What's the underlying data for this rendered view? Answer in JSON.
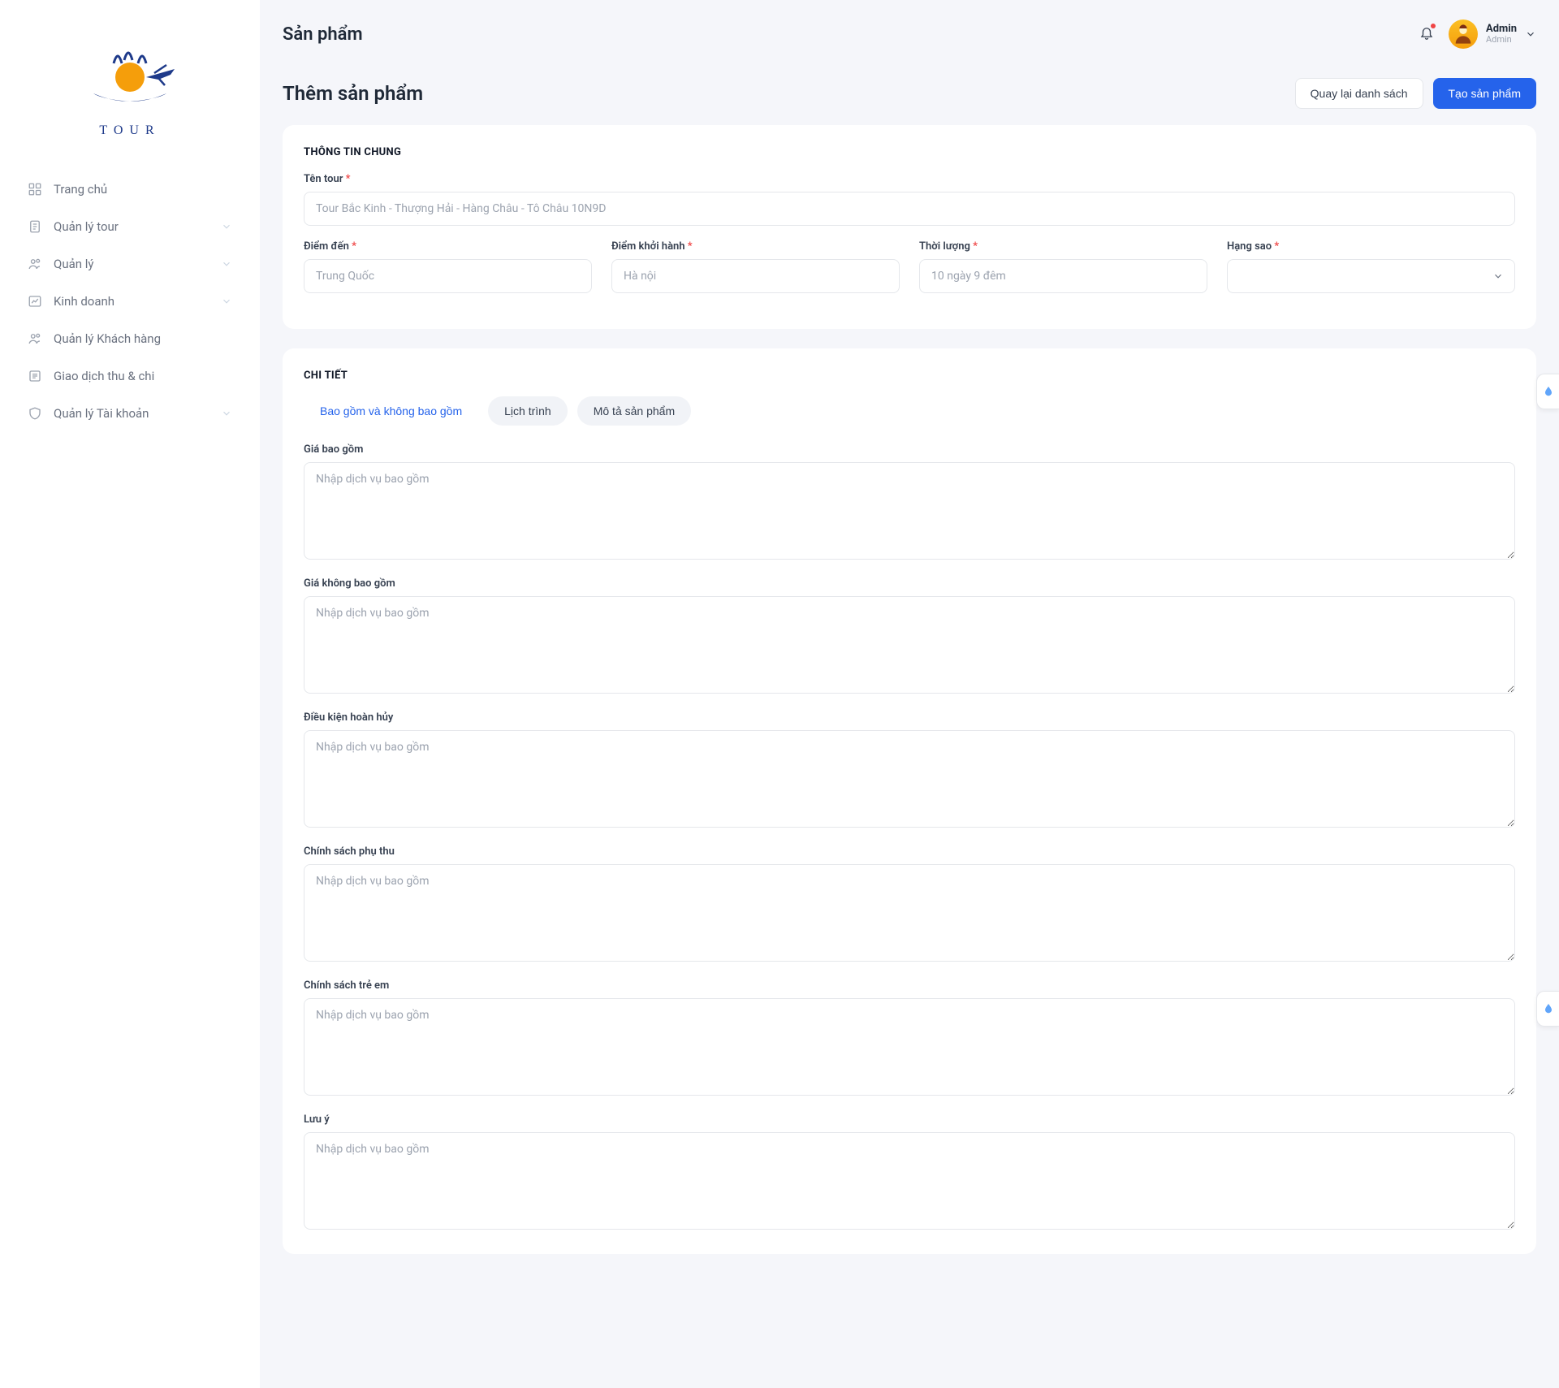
{
  "brand": {
    "name": "TOUR"
  },
  "sidebar": {
    "items": [
      {
        "label": "Trang chủ",
        "expandable": false
      },
      {
        "label": "Quản lý tour",
        "expandable": true
      },
      {
        "label": "Quản lý",
        "expandable": true
      },
      {
        "label": "Kinh doanh",
        "expandable": true
      },
      {
        "label": "Quản lý Khách hàng",
        "expandable": false
      },
      {
        "label": "Giao dịch thu & chi",
        "expandable": false
      },
      {
        "label": "Quản lý Tài khoản",
        "expandable": true
      }
    ]
  },
  "header": {
    "title": "Sản phẩm",
    "user": {
      "name": "Admin",
      "role": "Admin"
    }
  },
  "subheader": {
    "title": "Thêm sản phẩm",
    "back_btn": "Quay lại danh sách",
    "create_btn": "Tạo sản phẩm"
  },
  "section_general": {
    "heading": "THÔNG TIN CHUNG",
    "tour_name": {
      "label": "Tên tour",
      "placeholder": "Tour Bắc Kinh - Thượng Hải - Hàng Châu - Tô Châu 10N9D"
    },
    "destination": {
      "label": "Điểm đến",
      "placeholder": "Trung Quốc"
    },
    "departure": {
      "label": "Điểm khởi hành",
      "placeholder": "Hà nội"
    },
    "duration": {
      "label": "Thời lượng",
      "placeholder": "10 ngày 9 đêm"
    },
    "star": {
      "label": "Hạng sao"
    }
  },
  "section_detail": {
    "heading": "CHI TIẾT",
    "tabs": [
      {
        "label": "Bao gồm và không bao gồm",
        "active": true,
        "pill": false
      },
      {
        "label": "Lịch trình",
        "active": false,
        "pill": true
      },
      {
        "label": "Mô tả sản phẩm",
        "active": false,
        "pill": true
      }
    ],
    "fields": [
      {
        "label": "Giá bao gồm",
        "placeholder": "Nhập dịch vụ bao gồm"
      },
      {
        "label": "Giá không bao gồm",
        "placeholder": "Nhập dịch vụ bao gồm"
      },
      {
        "label": "Điều kiện hoàn hủy",
        "placeholder": "Nhập dịch vụ bao gồm"
      },
      {
        "label": "Chính sách phụ thu",
        "placeholder": "Nhập dịch vụ bao gồm"
      },
      {
        "label": "Chính sách trẻ em",
        "placeholder": "Nhập dịch vụ bao gồm"
      },
      {
        "label": "Lưu ý",
        "placeholder": "Nhập dịch vụ bao gồm"
      }
    ]
  }
}
